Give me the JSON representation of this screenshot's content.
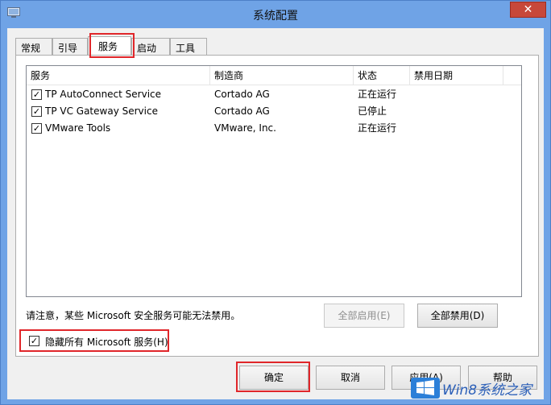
{
  "window": {
    "title": "系统配置",
    "close_glyph": "✕",
    "app_icon": "msconfig-icon"
  },
  "tabs": [
    {
      "label": "常规",
      "active": false
    },
    {
      "label": "引导",
      "active": false
    },
    {
      "label": "服务",
      "active": true
    },
    {
      "label": "启动",
      "active": false
    },
    {
      "label": "工具",
      "active": false
    }
  ],
  "services": {
    "columns": [
      "服务",
      "制造商",
      "状态",
      "禁用日期"
    ],
    "rows": [
      {
        "checked": true,
        "name": "TP AutoConnect Service",
        "vendor": "Cortado AG",
        "status": "正在运行",
        "disabled_date": ""
      },
      {
        "checked": true,
        "name": "TP VC Gateway Service",
        "vendor": "Cortado AG",
        "status": "已停止",
        "disabled_date": ""
      },
      {
        "checked": true,
        "name": "VMware Tools",
        "vendor": "VMware, Inc.",
        "status": "正在运行",
        "disabled_date": ""
      }
    ]
  },
  "note": "请注意，某些 Microsoft 安全服务可能无法禁用。",
  "enable_all_label": "全部启用(E)",
  "disable_all_label": "全部禁用(D)",
  "hide_ms": {
    "checked": true,
    "label": "隐藏所有 Microsoft 服务(H)"
  },
  "footer": {
    "ok": "确定",
    "cancel": "取消",
    "apply": "应用(A)",
    "help": "帮助"
  },
  "watermark": {
    "text": "Win8系统之家",
    "logo": "windows-logo-icon"
  },
  "colors": {
    "highlight": "#e0262a",
    "window_frame": "#6fa3e6",
    "close": "#c7483a"
  }
}
